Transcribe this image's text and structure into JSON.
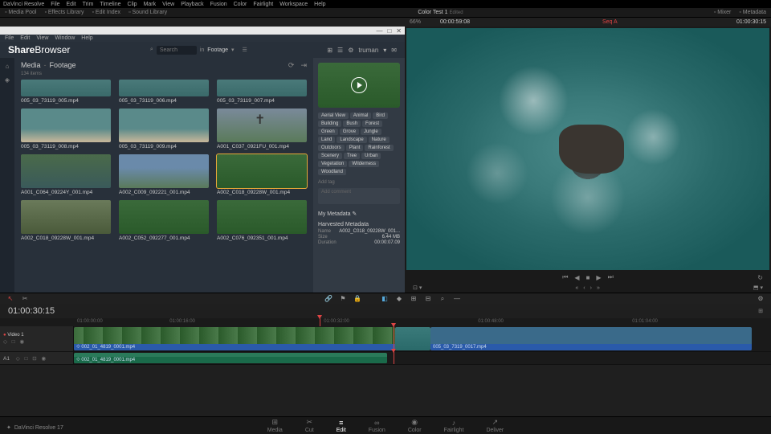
{
  "menubar": [
    "DaVinci Resolve",
    "File",
    "Edit",
    "Trim",
    "Timeline",
    "Clip",
    "Mark",
    "View",
    "Playback",
    "Fusion",
    "Color",
    "Fairlight",
    "Workspace",
    "Help"
  ],
  "topbar": {
    "left": [
      "Media Pool",
      "Effects Library",
      "Edit Index",
      "Sound Library"
    ],
    "title": "Color Test 1",
    "edited": "Edited",
    "right": [
      "Mixer",
      "Metadata"
    ]
  },
  "timebar": {
    "zoom": "66%",
    "tc": "00:00:59:08",
    "seq": "Seq A",
    "total": "01:00:30:15"
  },
  "sb": {
    "winmenu": [
      "File",
      "Edit",
      "View",
      "Window",
      "Help"
    ],
    "logo1": "Share",
    "logo2": "Browser",
    "search_ph": "Search",
    "in": "in",
    "scope": "Footage",
    "user": "truman",
    "crumb1": "Media",
    "crumb2": "Footage",
    "count": "134 items",
    "thumbs": [
      {
        "name": "005_03_73119_005.mp4",
        "cls": "ocean half"
      },
      {
        "name": "005_03_73119_006.mp4",
        "cls": "ocean half"
      },
      {
        "name": "005_03_73119_007.mp4",
        "cls": "ocean half"
      },
      {
        "name": "005_03_73119_008.mp4",
        "cls": "beach"
      },
      {
        "name": "005_03_73119_009.mp4",
        "cls": "beach"
      },
      {
        "name": "A001_C037_0921FU_001.mp4",
        "cls": "cross"
      },
      {
        "name": "A001_C064_09224Y_001.mp4",
        "cls": "river"
      },
      {
        "name": "A002_C009_092221_001.mp4",
        "cls": "town"
      },
      {
        "name": "A002_C018_09228W_001.mp4",
        "cls": "forest",
        "sel": true
      },
      {
        "name": "A002_C018_09228W_001.mp4",
        "cls": "path"
      },
      {
        "name": "A002_C052_092277_001.mp4",
        "cls": "forest"
      },
      {
        "name": "A002_C076_092351_001.mp4",
        "cls": "forest"
      }
    ],
    "tags": [
      "Aerial View",
      "Animal",
      "Bird",
      "Building",
      "Bush",
      "Forest",
      "Green",
      "Grove",
      "Jungle",
      "Land",
      "Landscape",
      "Nature",
      "Outdoors",
      "Plant",
      "Rainforest",
      "Scenery",
      "Tree",
      "Urban",
      "Vegetation",
      "Wilderness",
      "Woodland"
    ],
    "addtag": "Add tag",
    "comment_ph": "Add comment",
    "mymeta": "My Metadata",
    "harvested": "Harvested Metadata",
    "meta": [
      {
        "k": "Name",
        "v": "A002_C018_09228W_001..."
      },
      {
        "k": "Size",
        "v": "6.44 MB"
      },
      {
        "k": "Duration",
        "v": "00:00:07.09"
      }
    ]
  },
  "tl": {
    "tc": "01:00:30:15",
    "ruler": [
      {
        "p": 10,
        "t": "01:00:00:00"
      },
      {
        "p": 22,
        "t": "01:00:16:00"
      },
      {
        "p": 42,
        "t": "01:00:32:00"
      },
      {
        "p": 62,
        "t": "01:00:48:00"
      },
      {
        "p": 82,
        "t": "01:01:04:00"
      }
    ],
    "v1": "Video 1",
    "a1": "A1",
    "clip_v1": "002_01_4819_0001.mp4",
    "clip_v2": "005_03_7319_0017.mp4",
    "clip_a1": "002_01_4819_0001.mp4"
  },
  "pages": [
    "Media",
    "Cut",
    "Edit",
    "Fusion",
    "Color",
    "Fairlight",
    "Deliver"
  ],
  "pageicons": [
    "⊞",
    "✂",
    "≡",
    "∞",
    "◉",
    "♪",
    "↗"
  ],
  "active_page": 2,
  "footer": "DaVinci Resolve 17"
}
